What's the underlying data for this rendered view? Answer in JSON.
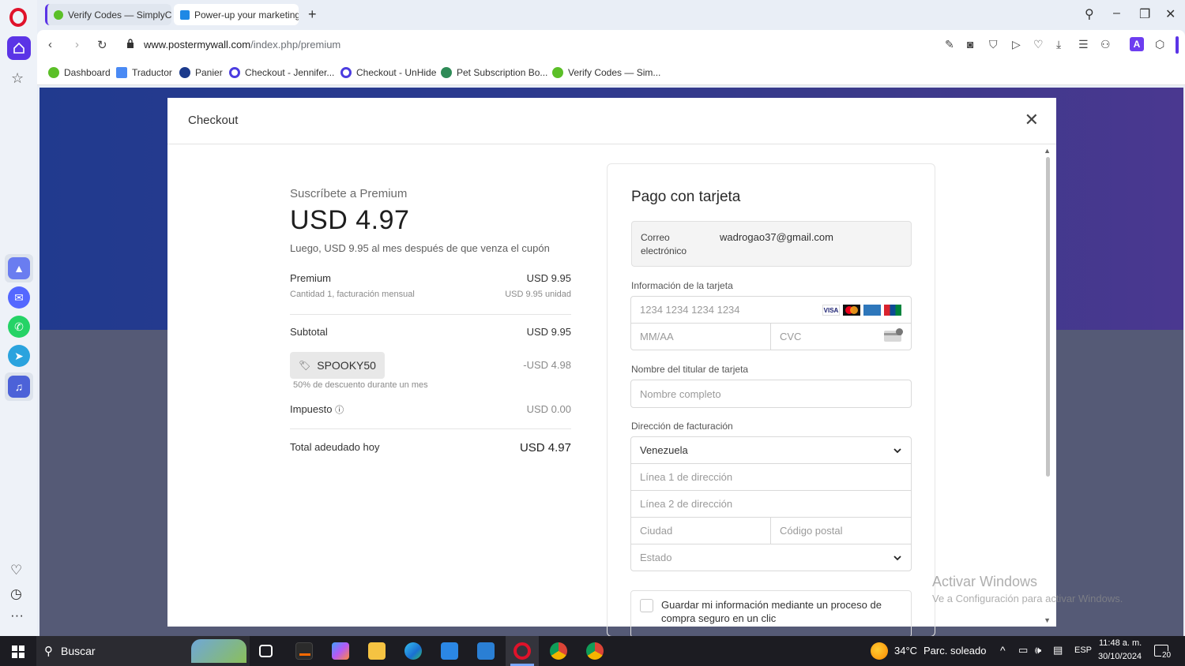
{
  "browser": {
    "tabs": [
      {
        "label": "Verify Codes — SimplyCo"
      },
      {
        "label": "Power-up your marketing"
      }
    ],
    "url": {
      "domain": "www.postermywall.com",
      "path": "/index.php/premium"
    },
    "bookmarks": [
      {
        "label": "Dashboard"
      },
      {
        "label": "Traductor"
      },
      {
        "label": "Panier"
      },
      {
        "label": "Checkout - Jennifer..."
      },
      {
        "label": "Checkout - UnHide"
      },
      {
        "label": "Pet Subscription Bo..."
      },
      {
        "label": "Verify Codes — Sim..."
      }
    ]
  },
  "modal": {
    "title": "Checkout",
    "summary": {
      "subtitle": "Suscríbete a Premium",
      "price": "USD 4.97",
      "note": "Luego, USD 9.95 al mes después de que venza el cupón",
      "item_name": "Premium",
      "item_price": "USD 9.95",
      "item_desc": "Cantidad 1, facturación mensual",
      "item_unit": "USD 9.95 unidad",
      "subtotal_label": "Subtotal",
      "subtotal_value": "USD 9.95",
      "coupon_code": "SPOOKY50",
      "coupon_value": "-USD 4.98",
      "coupon_desc": "50% de descuento durante un mes",
      "tax_label": "Impuesto",
      "tax_value": "USD 0.00",
      "total_label": "Total adeudado hoy",
      "total_value": "USD 4.97"
    },
    "payment": {
      "title": "Pago con tarjeta",
      "email_label_1": "Correo",
      "email_label_2": "electrónico",
      "email_value": "wadrogao37@gmail.com",
      "card_info_label": "Información de la tarjeta",
      "card_number_placeholder": "1234 1234 1234 1234",
      "expiry_placeholder": "MM/AA",
      "cvc_placeholder": "CVC",
      "holder_label": "Nombre del titular de tarjeta",
      "holder_placeholder": "Nombre completo",
      "billing_label": "Dirección de facturación",
      "country_value": "Venezuela",
      "address1_placeholder": "Línea 1 de dirección",
      "address2_placeholder": "Línea 2 de dirección",
      "city_placeholder": "Ciudad",
      "postal_placeholder": "Código postal",
      "state_placeholder": "Estado",
      "save_info_1": "Guardar mi información mediante un proceso de",
      "save_info_2": "compra seguro en un clic"
    }
  },
  "watermark": {
    "line1": "Activar Windows",
    "line2": "Ve a Configuración para activar Windows."
  },
  "taskbar": {
    "search_label": "Buscar",
    "weather_temp": "34°C",
    "weather_desc": "Parc. soleado",
    "language": "ESP",
    "time": "11:48 a. m.",
    "date": "30/10/2024",
    "notification_count": "20"
  }
}
